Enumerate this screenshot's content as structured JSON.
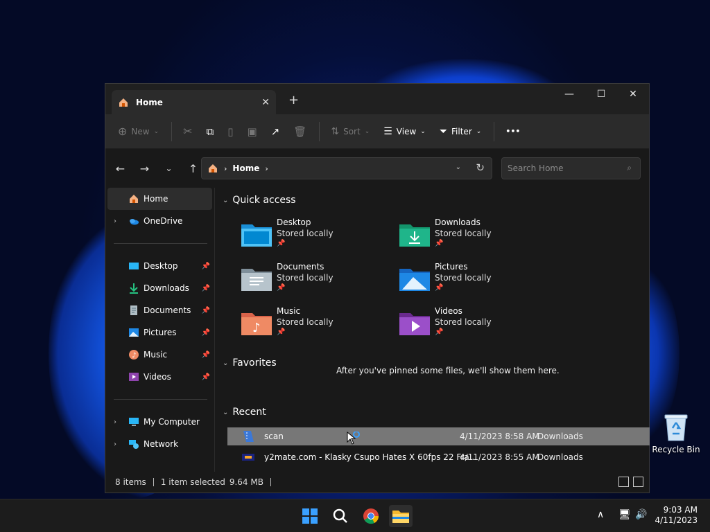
{
  "desktop": {
    "recycle_bin": "Recycle Bin"
  },
  "window": {
    "tab_title": "Home",
    "close_tab": "✕",
    "new_tab": "+",
    "controls": {
      "minimize": "—",
      "maximize": "☐",
      "close": "✕"
    },
    "toolbar": {
      "new": "New",
      "sort": "Sort",
      "view": "View",
      "filter": "Filter",
      "more": "•••"
    },
    "address": {
      "location": "Home",
      "separator": "›"
    },
    "search": {
      "placeholder": "Search Home"
    },
    "sidebar": {
      "home": "Home",
      "onedrive": "OneDrive",
      "items": [
        {
          "label": "Desktop",
          "icon": "desktop-icon"
        },
        {
          "label": "Downloads",
          "icon": "downloads-icon"
        },
        {
          "label": "Documents",
          "icon": "documents-icon"
        },
        {
          "label": "Pictures",
          "icon": "pictures-icon"
        },
        {
          "label": "Music",
          "icon": "music-icon"
        },
        {
          "label": "Videos",
          "icon": "videos-icon"
        }
      ],
      "my_computer": "My Computer",
      "network": "Network"
    },
    "quick_access": {
      "heading": "Quick access",
      "folders": [
        {
          "name": "Desktop",
          "status": "Stored locally"
        },
        {
          "name": "Downloads",
          "status": "Stored locally"
        },
        {
          "name": "Documents",
          "status": "Stored locally"
        },
        {
          "name": "Pictures",
          "status": "Stored locally"
        },
        {
          "name": "Music",
          "status": "Stored locally"
        },
        {
          "name": "Videos",
          "status": "Stored locally"
        }
      ]
    },
    "favorites": {
      "heading": "Favorites",
      "empty": "After you've pinned some files, we'll show them here."
    },
    "recent": {
      "heading": "Recent",
      "files": [
        {
          "name": "scan",
          "date": "4/11/2023 8:58 AM",
          "location": "Downloads"
        },
        {
          "name": "y2mate.com - Klasky Csupo Hates X 60fps 22 Fra...",
          "date": "4/11/2023 8:55 AM",
          "location": "Downloads"
        }
      ]
    },
    "status": {
      "count": "8 items",
      "selected": "1 item selected",
      "size": "9.64 MB"
    }
  },
  "taskbar": {
    "time": "9:03 AM",
    "date": "4/11/2023"
  },
  "colors": {
    "accent": "#0067c0",
    "selection": "#777777",
    "window_bg": "#191919"
  }
}
